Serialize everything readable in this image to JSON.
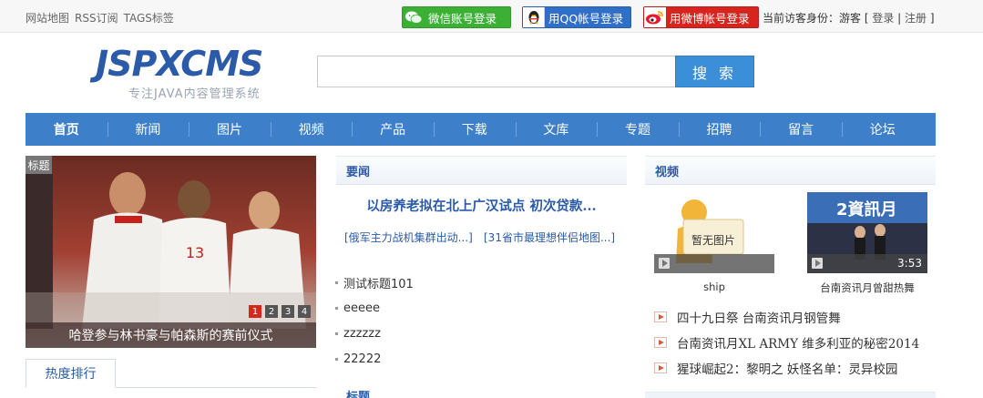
{
  "topbar": {
    "links": [
      "网站地图",
      "RSS订阅",
      "TAGS标签"
    ],
    "wechat_login": "微信账号登录",
    "qq_login": "用QQ帐号登录",
    "weibo_login": "用微博帐号登录",
    "visitor_prefix": "当前访客身份：游客 [",
    "login": "登录",
    "sep": "|",
    "register": "注册",
    "visitor_suffix": "]"
  },
  "header": {
    "logo_text": "JSPXCMS",
    "logo_sub": "专注JAVA内容管理系统",
    "search_placeholder": "",
    "search_button": "搜 索"
  },
  "nav": {
    "items": [
      "首页",
      "新闻",
      "图片",
      "视频",
      "产品",
      "下载",
      "文库",
      "专题",
      "招聘",
      "留言",
      "论坛"
    ]
  },
  "slideshow": {
    "tag": "标题",
    "caption": "哈登参与林书豪与帕森斯的赛前仪式",
    "pages": [
      "1",
      "2",
      "3",
      "4"
    ],
    "active_page": 1
  },
  "hot": {
    "tab_label": "热度排行"
  },
  "news": {
    "header": "要闻",
    "headline": "以房养老拟在北上广汉试点 初次贷款...",
    "sub1": "[俄军主力战机集群出动...]",
    "sub2": "[31省市最理想伴侣地图...]",
    "items": [
      "测试标题101",
      "eeeee",
      "zzzzzz",
      "22222"
    ],
    "next_header": "标题"
  },
  "video": {
    "header": "视频",
    "items": [
      {
        "caption": "ship",
        "placeholder_text": "暂无图片",
        "duration": ""
      },
      {
        "caption": "台南资讯月曾甜热舞",
        "overlay_text": "2資訊月",
        "duration": "3:53"
      }
    ],
    "list": [
      "四十九日祭 台南资讯月钢管舞",
      "台南资讯月XL ARMY 维多利亚的秘密2014",
      "猩球崛起2：黎明之 妖怪名单：灵异校园"
    ]
  },
  "colors": {
    "nav_bg": "#3d7fc9",
    "brand_blue": "#2a5aa8",
    "search_btn": "#3b8fd9",
    "wechat_green": "#3bb035",
    "qq_blue": "#2f6fc8",
    "weibo_red": "#d8241f",
    "active_dot": "#d9261c"
  }
}
